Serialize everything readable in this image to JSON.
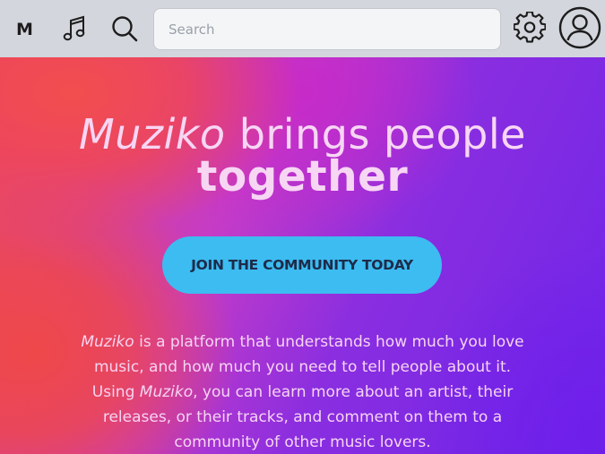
{
  "nav": {
    "logo": "M",
    "search_placeholder": "Search",
    "icons": [
      "music-note-icon",
      "search-icon",
      "gear-icon",
      "user-icon"
    ]
  },
  "hero": {
    "brand": "Muziko",
    "headline_rest": " brings people",
    "headline_strong": "together",
    "cta_label": "JOIN THE COMMUNITY TODAY",
    "desc_brand_1": "Muziko",
    "desc_part_1": " is a platform that understands how much you love music, and how much you need to tell people about it. Using ",
    "desc_brand_2": "Muziko",
    "desc_part_2": ", you can learn more about an artist, their releases, or their tracks, and comment on them to a community of other music lovers."
  },
  "colors": {
    "navbar_bg": "#d3d6dc",
    "cta_bg": "#3cbcf1",
    "text_light": "#f7d6f4",
    "gradient_red": "#ee4a5a",
    "gradient_purple": "#6f25e8"
  }
}
